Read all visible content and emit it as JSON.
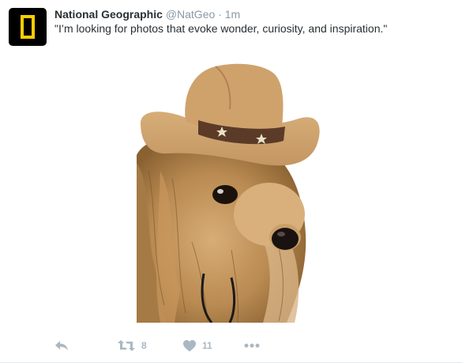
{
  "tweet": {
    "author": {
      "name": "National Geographic",
      "handle": "@NatGeo",
      "separator": "·",
      "time": "1m"
    },
    "text": "\"I’m looking for photos that evoke wonder, curiosity, and inspiration.\"",
    "media": {
      "icon": "photo-dog-cowboy-hat"
    },
    "actions": {
      "reply_icon": "reply-icon",
      "retweet_icon": "retweet-icon",
      "retweet_count": "8",
      "like_icon": "heart-icon",
      "like_count": "11",
      "more_icon": "more-icon"
    },
    "colors": {
      "name": "#292f33",
      "meta": "#8899a6",
      "action": "#aab8c2",
      "avatar_bg": "#000000",
      "avatar_frame": "#ffce00"
    }
  }
}
